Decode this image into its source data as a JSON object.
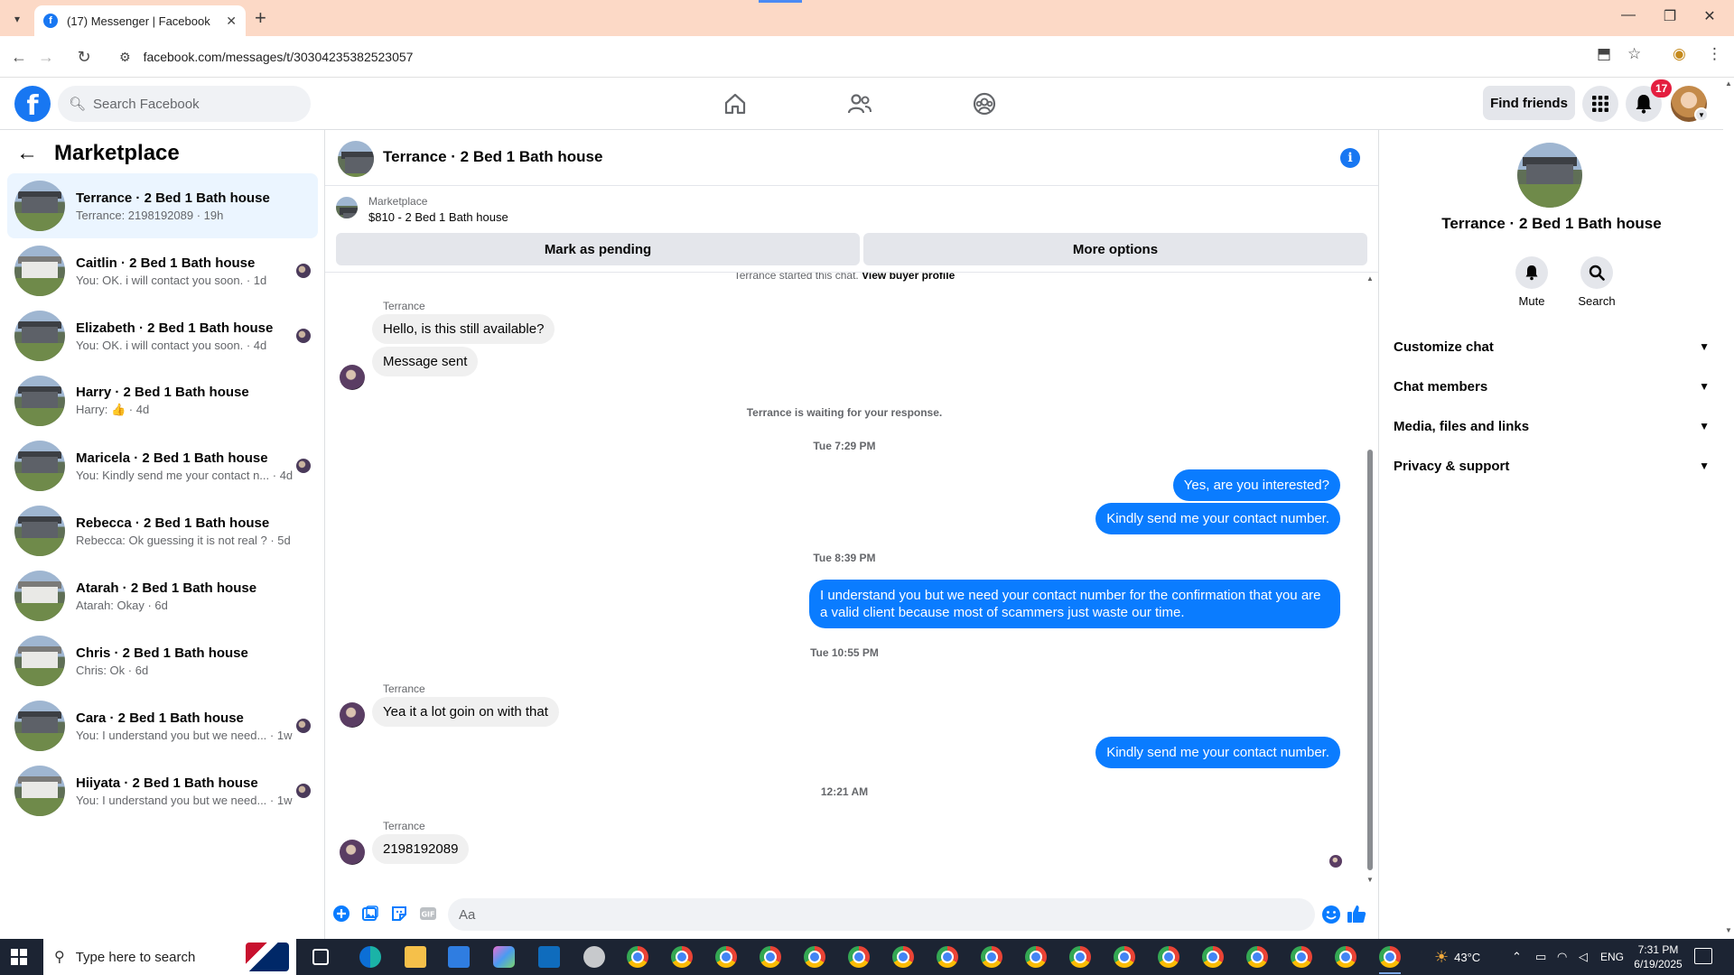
{
  "browser": {
    "tab_title": "(17) Messenger | Facebook",
    "url": "facebook.com/messages/t/30304235382523057"
  },
  "fb_nav": {
    "search_placeholder": "Search Facebook",
    "find_friends": "Find friends",
    "notification_count": "17"
  },
  "left_panel": {
    "title": "Marketplace",
    "chats": [
      {
        "name": "Terrance · 2 Bed 1 Bath house",
        "preview": "Terrance: 2198192089 · 19h",
        "active": true
      },
      {
        "name": "Caitlin · 2 Bed 1 Bath house",
        "preview": "You: OK. i will contact you soon. · 1d"
      },
      {
        "name": "Elizabeth · 2 Bed 1 Bath house",
        "preview": "You: OK. i will contact you soon. · 4d"
      },
      {
        "name": "Harry · 2 Bed 1 Bath house",
        "preview": "Harry: 👍 · 4d"
      },
      {
        "name": "Maricela · 2 Bed 1 Bath house",
        "preview": "You: Kindly send me your contact n... · 4d"
      },
      {
        "name": "Rebecca · 2 Bed 1 Bath house",
        "preview": "Rebecca: Ok guessing it is not real ? · 5d"
      },
      {
        "name": "Atarah · 2 Bed 1 Bath house",
        "preview": "Atarah: Okay · 6d"
      },
      {
        "name": "Chris · 2 Bed 1 Bath house",
        "preview": "Chris: Ok · 6d"
      },
      {
        "name": "Cara · 2 Bed 1 Bath house",
        "preview": "You: I understand you but we need... · 1w"
      },
      {
        "name": "Hiiyata · 2 Bed 1 Bath house",
        "preview": "You: I understand you but we need... · 1w"
      }
    ]
  },
  "conversation": {
    "title": "Terrance · 2 Bed 1 Bath house",
    "listing_label": "Marketplace",
    "listing_price": "$810 - 2 Bed 1 Bath house",
    "mark_pending": "Mark as pending",
    "more_options": "More options",
    "started_text": "Terrance started this chat.",
    "view_buyer_profile": "View buyer profile",
    "sender_name": "Terrance",
    "msg_in_1": "Hello, is this still available?",
    "msg_in_2": "Message sent",
    "waiting": "Terrance is waiting for your response.",
    "ts_1": "Tue 7:29 PM",
    "msg_out_1": "Yes, are you interested?",
    "msg_out_2": "Kindly send me your contact number.",
    "ts_2": "Tue 8:39 PM",
    "msg_out_3": "I  understand you  but we need your contact number for the confirmation that you are a valid client because most of scammers just waste our time.",
    "ts_3": "Tue 10:55 PM",
    "msg_in_3": "Yea it a lot goin on with that",
    "msg_out_4": "Kindly send me your contact number.",
    "ts_4": "12:21 AM",
    "msg_in_4": "2198192089",
    "input_placeholder": "Aa"
  },
  "right_panel": {
    "name": "Terrance · 2 Bed 1 Bath house",
    "mute": "Mute",
    "search": "Search",
    "sections": [
      "Customize chat",
      "Chat members",
      "Media, files and links",
      "Privacy & support"
    ]
  },
  "taskbar": {
    "search_placeholder": "Type here to search",
    "temperature": "43°C",
    "language": "ENG",
    "time": "7:31 PM",
    "date": "6/19/2025"
  },
  "colors": {
    "fb_blue": "#1877f2",
    "outgoing_bubble": "#0a7cff",
    "tab_strip": "#fcd9c6"
  }
}
